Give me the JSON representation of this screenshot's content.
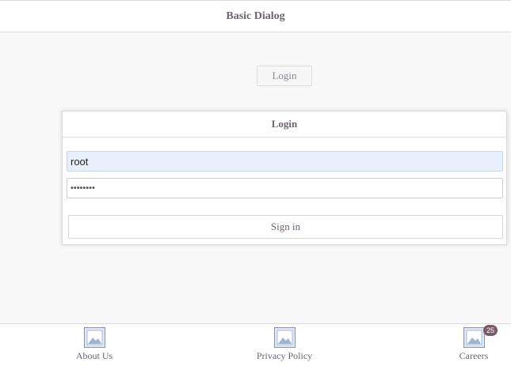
{
  "header": {
    "title": "Basic Dialog"
  },
  "login_trigger": {
    "label": "Login"
  },
  "dialog": {
    "title": "Login",
    "username_value": "root",
    "password_value": "••••••••",
    "signin_label": "Sign in"
  },
  "footer": {
    "items": [
      {
        "label": "About Us",
        "icon": "image-icon"
      },
      {
        "label": "Privacy Policy",
        "icon": "image-icon"
      },
      {
        "label": "Careers",
        "icon": "image-icon",
        "badge": "25"
      }
    ]
  },
  "colors": {
    "accent_text": "#6d6375",
    "badge_bg": "#7a5b66",
    "autofill_bg": "#e8f0fe"
  }
}
